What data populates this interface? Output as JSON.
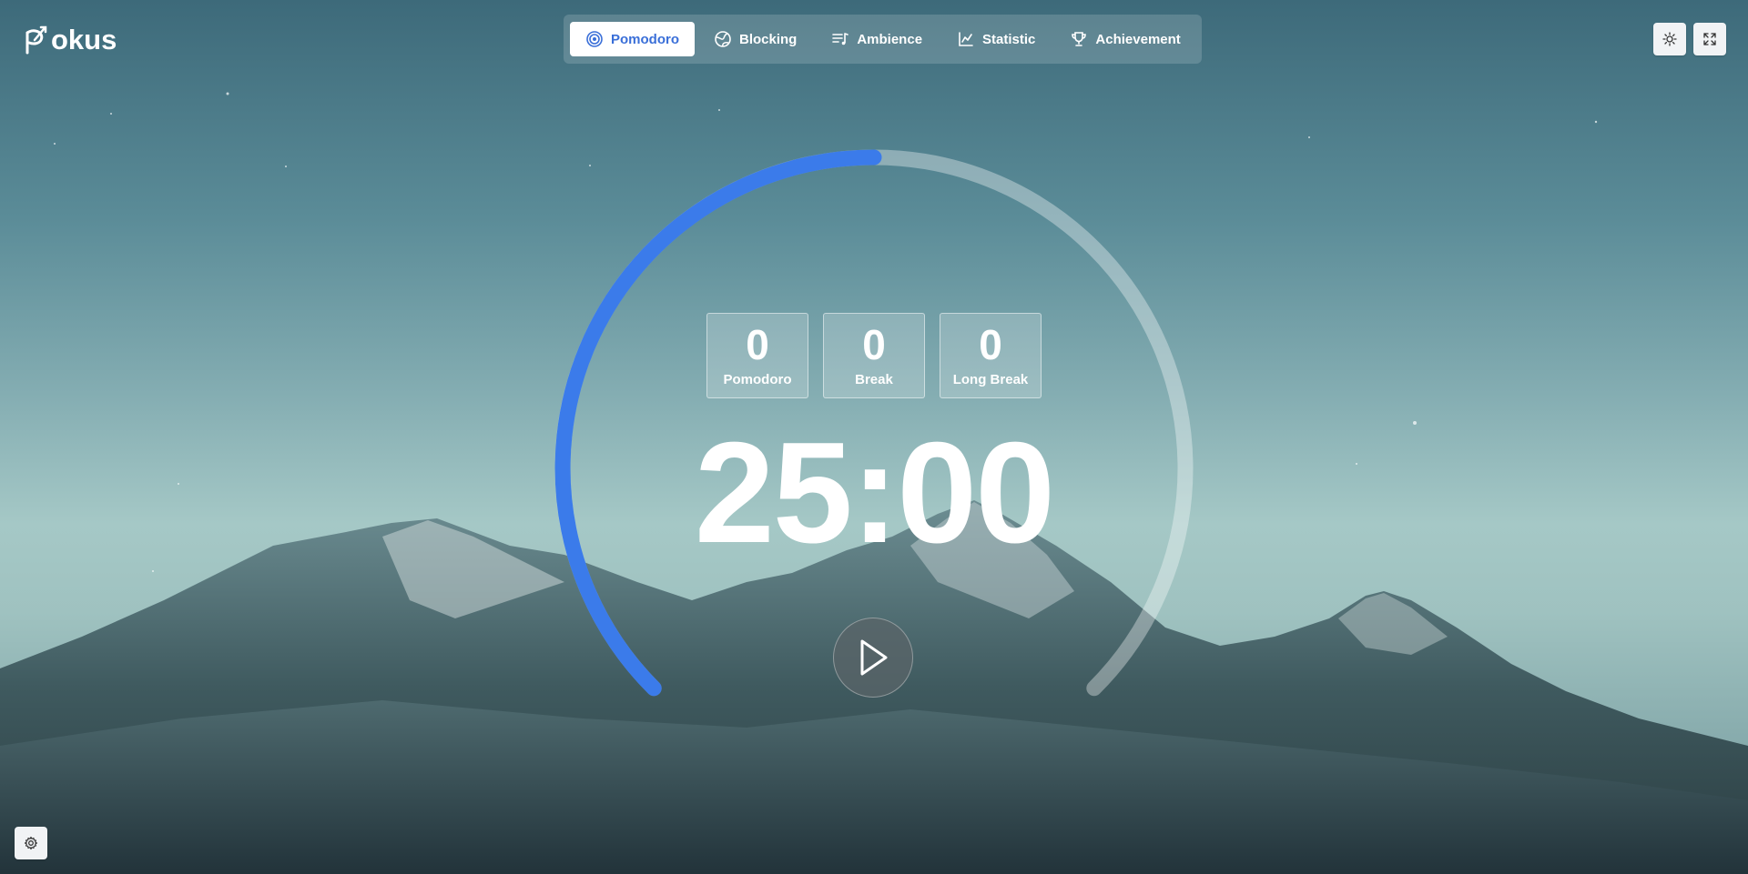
{
  "app": {
    "logo_text": "okus"
  },
  "nav": {
    "tabs": [
      {
        "label": "Pomodoro",
        "icon": "target-icon"
      },
      {
        "label": "Blocking",
        "icon": "globe-icon"
      },
      {
        "label": "Ambience",
        "icon": "music-list-icon"
      },
      {
        "label": "Statistic",
        "icon": "line-chart-icon"
      },
      {
        "label": "Achievement",
        "icon": "trophy-icon"
      }
    ],
    "active_tab": "Pomodoro"
  },
  "header_actions": {
    "theme_icon": "sun-icon",
    "fullscreen_icon": "expand-icon"
  },
  "counters": [
    {
      "value": "0",
      "label": "Pomodoro"
    },
    {
      "value": "0",
      "label": "Break"
    },
    {
      "value": "0",
      "label": "Long Break"
    }
  ],
  "timer": {
    "display": "25:00",
    "progress": 0.5
  },
  "controls": {
    "play_icon": "play-icon",
    "settings_icon": "gear-icon"
  },
  "colors": {
    "accent": "#3a6fd8",
    "ring_progress": "#3b7bea",
    "ring_track": "rgba(255,255,255,0.35)"
  }
}
